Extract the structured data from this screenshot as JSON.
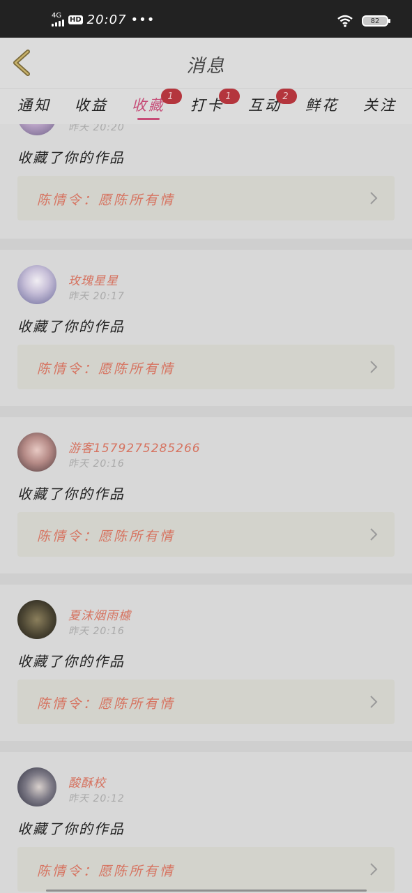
{
  "status_bar": {
    "network": "4G",
    "hd": "HD",
    "time": "20:07",
    "dots": "•••",
    "battery": "82"
  },
  "header": {
    "title": "消息"
  },
  "tabs": [
    {
      "label": "通知",
      "badge": null
    },
    {
      "label": "收益",
      "badge": null
    },
    {
      "label": "收藏",
      "badge": "1",
      "active": true
    },
    {
      "label": "打卡",
      "badge": "1"
    },
    {
      "label": "互动",
      "badge": "2"
    },
    {
      "label": "鲜花",
      "badge": null
    },
    {
      "label": "关注",
      "badge": null
    }
  ],
  "messages": [
    {
      "user": "",
      "time": "昨天 20:20",
      "action": "收藏了你的作品",
      "work": "陈情令：愿陈所有情"
    },
    {
      "user": "玫瑰星星",
      "time": "昨天 20:17",
      "action": "收藏了你的作品",
      "work": "陈情令：愿陈所有情"
    },
    {
      "user": "游客1579275285266",
      "time": "昨天 20:16",
      "action": "收藏了你的作品",
      "work": "陈情令：愿陈所有情"
    },
    {
      "user": "夏沫烟雨櫖",
      "time": "昨天 20:16",
      "action": "收藏了你的作品",
      "work": "陈情令：愿陈所有情"
    },
    {
      "user": "酸酥校",
      "time": "昨天 20:12",
      "action": "收藏了你的作品",
      "work": "陈情令：愿陈所有情"
    }
  ],
  "colors": {
    "accent": "#c64c77",
    "badge": "#b4353d",
    "username": "#d67360"
  },
  "icons": {
    "back": "chevron-left-icon",
    "row_arrow": "chevron-right-icon"
  }
}
